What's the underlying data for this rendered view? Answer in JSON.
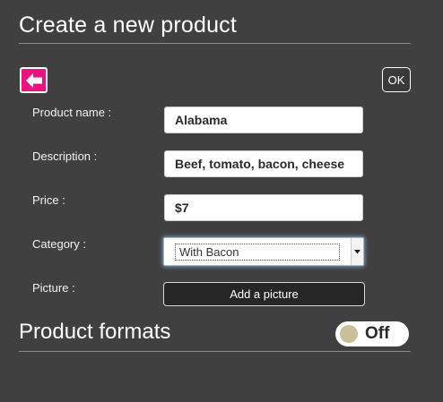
{
  "header": {
    "title": "Create a new product"
  },
  "toolbar": {
    "ok_label": "OK"
  },
  "colors": {
    "back_button": "#e8137e",
    "toggle_knob": "#c8c09a"
  },
  "icons": {
    "back": "arrow-left-icon",
    "dropdown": "chevron-down-icon"
  },
  "form": {
    "name": {
      "label": "Product name :",
      "value": "Alabama"
    },
    "description": {
      "label": "Description :",
      "value": "Beef, tomato, bacon, cheese"
    },
    "price": {
      "label": "Price :",
      "value": "$7"
    },
    "category": {
      "label": "Category :",
      "selected": "With Bacon"
    },
    "picture": {
      "label": "Picture :",
      "button_label": "Add a picture"
    }
  },
  "formats": {
    "title": "Product formats",
    "toggle_label": "Off"
  }
}
